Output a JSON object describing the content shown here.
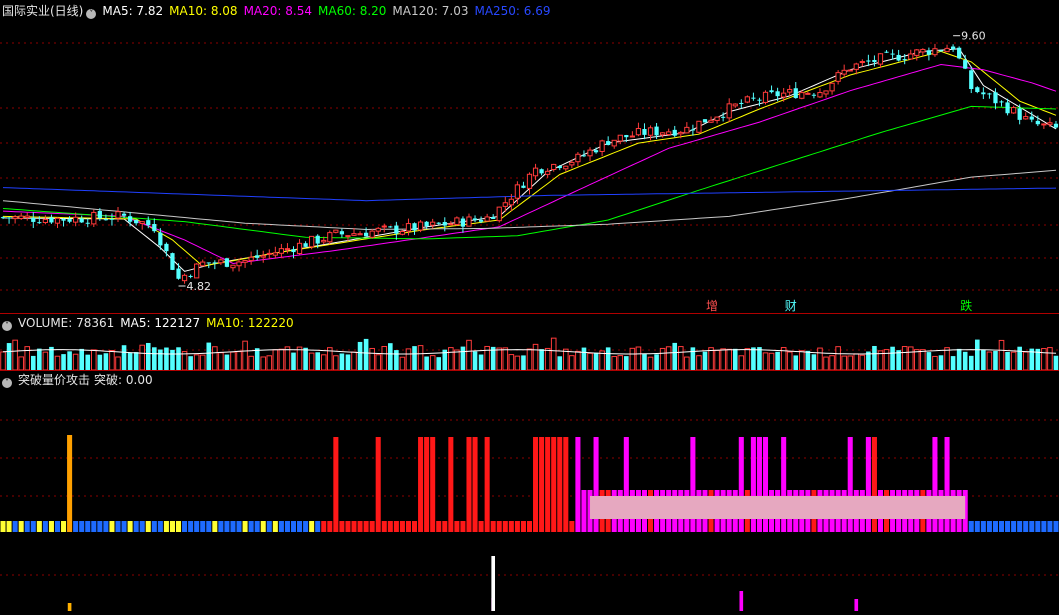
{
  "header_main": {
    "title": "国际实业(日线)",
    "ma5": "MA5: 7.82",
    "ma10": "MA10: 8.08",
    "ma20": "MA20: 8.54",
    "ma60": "MA60: 8.20",
    "ma120": "MA120: 7.03",
    "ma250": "MA250: 6.69"
  },
  "header_volume": {
    "title": "VOLUME: 78361",
    "ma5": "MA5: 122127",
    "ma10": "MA10: 122220"
  },
  "header_indicator": {
    "title": "突破量价攻击",
    "value": "突破: 0.00"
  },
  "colors": {
    "up": "#ff3b3b",
    "down": "#54ffff",
    "ma5": "#ffffff",
    "ma10": "#ffff00",
    "ma20": "#ff00ff",
    "ma60": "#00ff00",
    "ma120": "#c8c8c8",
    "ma250": "#2040ff",
    "grid": "#8b0000"
  },
  "chart_data": {
    "type": "candlestick",
    "count": 175,
    "ylim": [
      4.4,
      9.9
    ],
    "annotations": [
      {
        "text": "9.60",
        "index": 157,
        "value": 9.6
      },
      {
        "text": "4.82",
        "index": 29,
        "value": 4.82
      }
    ],
    "events": [
      {
        "text": "增",
        "index": 117,
        "color": "#ff5050"
      },
      {
        "text": "财",
        "index": 130,
        "color": "#54ffff"
      },
      {
        "text": "跌",
        "index": 159,
        "color": "#00ff00"
      }
    ],
    "anchors": [
      [
        0,
        6.13
      ],
      [
        10,
        6.1
      ],
      [
        20,
        6.15
      ],
      [
        25,
        5.95
      ],
      [
        29,
        4.95
      ],
      [
        33,
        5.25
      ],
      [
        40,
        5.3
      ],
      [
        55,
        5.8
      ],
      [
        70,
        5.95
      ],
      [
        80,
        6.12
      ],
      [
        82,
        6.3
      ],
      [
        88,
        7.05
      ],
      [
        95,
        7.25
      ],
      [
        100,
        7.6
      ],
      [
        106,
        7.75
      ],
      [
        113,
        7.82
      ],
      [
        118,
        8.1
      ],
      [
        122,
        8.3
      ],
      [
        128,
        8.48
      ],
      [
        135,
        8.55
      ],
      [
        140,
        9.0
      ],
      [
        145,
        9.15
      ],
      [
        152,
        9.3
      ],
      [
        157,
        9.4
      ],
      [
        160,
        8.6
      ],
      [
        165,
        8.3
      ],
      [
        170,
        7.92
      ],
      [
        174,
        7.82
      ]
    ],
    "ma_anchors": {
      "ma5": [
        [
          0,
          6.12
        ],
        [
          20,
          6.1
        ],
        [
          26,
          5.55
        ],
        [
          30,
          5.1
        ],
        [
          35,
          5.25
        ],
        [
          50,
          5.55
        ],
        [
          70,
          5.95
        ],
        [
          82,
          6.15
        ],
        [
          90,
          7.0
        ],
        [
          100,
          7.55
        ],
        [
          113,
          7.75
        ],
        [
          120,
          8.15
        ],
        [
          130,
          8.45
        ],
        [
          140,
          8.95
        ],
        [
          152,
          9.3
        ],
        [
          158,
          9.35
        ],
        [
          162,
          8.65
        ],
        [
          170,
          8.1
        ],
        [
          174,
          7.82
        ]
      ],
      "ma10": [
        [
          0,
          6.15
        ],
        [
          22,
          6.1
        ],
        [
          28,
          5.7
        ],
        [
          33,
          5.2
        ],
        [
          45,
          5.45
        ],
        [
          70,
          5.9
        ],
        [
          82,
          6.08
        ],
        [
          92,
          6.95
        ],
        [
          105,
          7.55
        ],
        [
          115,
          7.72
        ],
        [
          125,
          8.2
        ],
        [
          140,
          8.85
        ],
        [
          155,
          9.3
        ],
        [
          160,
          9.1
        ],
        [
          168,
          8.35
        ],
        [
          174,
          8.08
        ]
      ],
      "ma20": [
        [
          0,
          6.25
        ],
        [
          20,
          6.15
        ],
        [
          30,
          5.7
        ],
        [
          38,
          5.25
        ],
        [
          55,
          5.5
        ],
        [
          70,
          5.75
        ],
        [
          82,
          5.95
        ],
        [
          95,
          6.65
        ],
        [
          110,
          7.45
        ],
        [
          125,
          7.95
        ],
        [
          140,
          8.55
        ],
        [
          155,
          9.05
        ],
        [
          162,
          8.95
        ],
        [
          170,
          8.7
        ],
        [
          174,
          8.54
        ]
      ],
      "ma60": [
        [
          0,
          6.3
        ],
        [
          30,
          6.05
        ],
        [
          50,
          5.75
        ],
        [
          70,
          5.72
        ],
        [
          85,
          5.78
        ],
        [
          100,
          6.08
        ],
        [
          115,
          6.65
        ],
        [
          130,
          7.2
        ],
        [
          145,
          7.75
        ],
        [
          160,
          8.25
        ],
        [
          174,
          8.2
        ]
      ],
      "ma120": [
        [
          0,
          6.45
        ],
        [
          40,
          6.02
        ],
        [
          60,
          5.9
        ],
        [
          80,
          5.92
        ],
        [
          100,
          6.0
        ],
        [
          120,
          6.15
        ],
        [
          140,
          6.5
        ],
        [
          160,
          6.9
        ],
        [
          174,
          7.03
        ]
      ],
      "ma250": [
        [
          0,
          6.7
        ],
        [
          60,
          6.45
        ],
        [
          90,
          6.55
        ],
        [
          120,
          6.6
        ],
        [
          150,
          6.65
        ],
        [
          174,
          6.69
        ]
      ]
    },
    "volume_ylim": [
      0,
      220000
    ],
    "volume_last": 78361,
    "indicator_mode_segments": [
      {
        "from": 0,
        "to": 53,
        "mode": "blue_yellow"
      },
      {
        "from": 53,
        "to": 95,
        "mode": "red"
      },
      {
        "from": 95,
        "to": 160,
        "mode": "magenta_pink"
      },
      {
        "from": 160,
        "to": 175,
        "mode": "blue"
      }
    ],
    "indicator_lower_marks": [
      {
        "index": 11,
        "color": "#ffb000",
        "height": 8
      },
      {
        "index": 81,
        "color": "#ff00ff",
        "height": 13
      },
      {
        "index": 81,
        "color": "#ffffff",
        "height": 55
      },
      {
        "index": 122,
        "color": "#ff00ff",
        "height": 20
      },
      {
        "index": 141,
        "color": "#ff00ff",
        "height": 12
      }
    ]
  }
}
